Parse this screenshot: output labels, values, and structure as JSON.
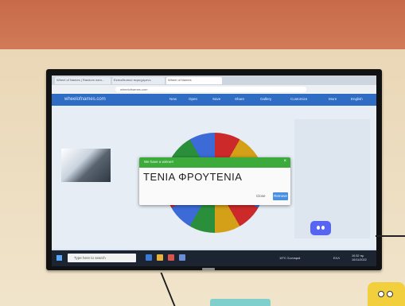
{
  "browser": {
    "tabs": [
      "Wheel of Names | Random nam...",
      "Εκπαιδευτικό περιεχόμενο",
      "Wheel of Names"
    ],
    "url": "wheelofnames.com"
  },
  "site": {
    "title": "wheelofnames.com",
    "nav": [
      "New",
      "Open",
      "Save",
      "Share",
      "Gallery",
      "Customize",
      "More",
      "English"
    ]
  },
  "modal": {
    "header": "We have a winner!",
    "close_glyph": "×",
    "winner": "ΤΕΝΙΑ ΦΡΟΥΤΕΝΙΑ",
    "close_label": "Close",
    "remove_label": "Remove"
  },
  "taskbar": {
    "search_placeholder": "Type here to search",
    "weather": "19°C Συννεφιά",
    "language": "ΕΛΛ",
    "time": "10:32 πμ",
    "date": "10/11/2022"
  },
  "colors": {
    "site_bar": "#2f6cc4",
    "modal_header": "#3cab3c",
    "remove_button": "#4b8fe0",
    "wall_top": "#c86a4a",
    "taskbar": "#1c2431"
  },
  "icons": [
    "windows-start-icon",
    "discord-icon",
    "close-icon"
  ]
}
